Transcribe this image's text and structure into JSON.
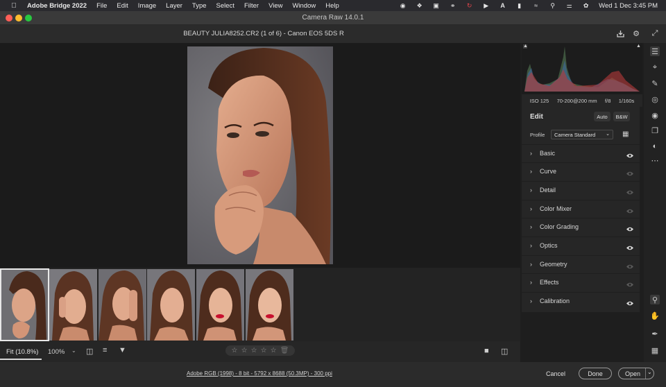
{
  "menubar": {
    "app": "Adobe Bridge 2022",
    "menus": [
      "File",
      "Edit",
      "Image",
      "Layer",
      "Type",
      "Select",
      "Filter",
      "View",
      "Window",
      "Help"
    ],
    "clock": "Wed 1 Dec  3:45 PM"
  },
  "window": {
    "title": "Camera Raw 14.0.1"
  },
  "header": {
    "file": "BEAUTY JULIA8252.CR2 (1 of 6)  -  Canon EOS 5DS R"
  },
  "exif": {
    "iso": "ISO 125",
    "lens": "70-200@200 mm",
    "aperture": "f/8",
    "shutter": "1/160s"
  },
  "edit": {
    "title": "Edit",
    "auto_label": "Auto",
    "bw_label": "B&W",
    "profile_label": "Profile",
    "profile_value": "Camera Standard",
    "sections": [
      {
        "label": "Basic",
        "eye_on": true
      },
      {
        "label": "Curve",
        "eye_on": false
      },
      {
        "label": "Detail",
        "eye_on": false
      },
      {
        "label": "Color Mixer",
        "eye_on": false
      },
      {
        "label": "Color Grading",
        "eye_on": true
      },
      {
        "label": "Optics",
        "eye_on": true
      },
      {
        "label": "Geometry",
        "eye_on": false
      },
      {
        "label": "Effects",
        "eye_on": false
      },
      {
        "label": "Calibration",
        "eye_on": true
      }
    ]
  },
  "toolbar": {
    "fit_label": "Fit (10.8%)",
    "zoom_label": "100%"
  },
  "footer": {
    "color_info": "Adobe RGB (1998) - 8 bit - 5792 x 8688 (50.3MP) - 300 ppi",
    "cancel": "Cancel",
    "done": "Done",
    "open": "Open"
  },
  "colors": {
    "accent": "#d0d0d0",
    "panel": "#262626",
    "canvas": "#1b1b1b"
  }
}
